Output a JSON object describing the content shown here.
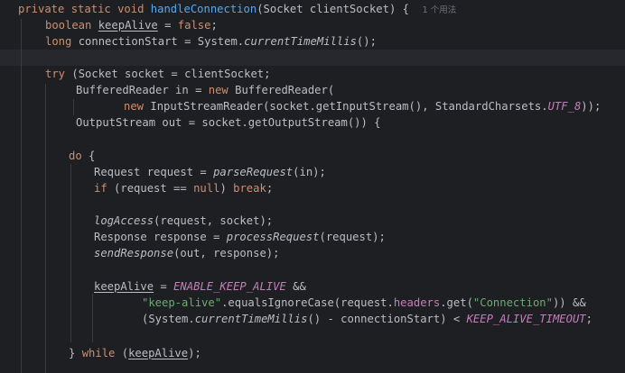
{
  "code": {
    "line1": {
      "kw_private": "private",
      "kw_static": "static",
      "kw_void": "void",
      "method_name": "handleConnection",
      "params": "(Socket clientSocket) {",
      "usage_hint": "1 个用法"
    },
    "line2": {
      "type": "boolean",
      "var": "keepAlive",
      "op": " = ",
      "value": "false",
      "end": ";"
    },
    "line3": {
      "type": "long",
      "var_decl": "connectionStart = System.",
      "method": "currentTimeMillis",
      "end": "();"
    },
    "line5": {
      "kw_try": "try",
      "rest": "(Socket socket = clientSocket;"
    },
    "line6": {
      "decl": "BufferedReader in = ",
      "kw_new": "new",
      "rest": " BufferedReader("
    },
    "line7": {
      "kw_new": "new",
      "rest": " InputStreamReader(socket.getInputStream(), StandardCharsets.",
      "const": "UTF_8",
      "end": "));"
    },
    "line8": {
      "text": "OutputStream out = socket.getOutputStream()) {"
    },
    "line10": {
      "kw_do": "do",
      "rest": " {"
    },
    "line11": {
      "decl": "Request request = ",
      "method": "parseRequest",
      "end": "(in);"
    },
    "line12": {
      "kw_if": "if",
      "mid": " (request == ",
      "kw_null": "null",
      "mid2": ") ",
      "kw_break": "break",
      "end": ";"
    },
    "line14": {
      "method": "logAccess",
      "end": "(request, socket);"
    },
    "line15": {
      "decl": "Response response = ",
      "method": "processRequest",
      "end": "(request);"
    },
    "line16": {
      "method": "sendResponse",
      "end": "(out, response);"
    },
    "line18": {
      "var": "keepAlive",
      "op": " = ",
      "const": "ENABLE_KEEP_ALIVE",
      "end": " &&"
    },
    "line19": {
      "string": "\"keep-alive\"",
      "mid": ".equalsIgnoreCase(request.",
      "field": "headers",
      "mid2": ".get(",
      "string2": "\"Connection\"",
      "end": ")) &&"
    },
    "line20": {
      "start": "(System.",
      "method": "currentTimeMillis",
      "mid": "() - connectionStart) < ",
      "const": "KEEP_ALIVE_TIMEOUT",
      "end": ";"
    },
    "line22": {
      "start": "} ",
      "kw_while": "while",
      "mid": " (",
      "var": "keepAlive",
      "end": ");"
    }
  },
  "colors": {
    "background": "#1e1f22",
    "current_line": "#26282e",
    "keyword": "#cf8e6d",
    "method_declaration": "#56a8f5",
    "field_constant": "#c77dbb",
    "string": "#6aab73",
    "default_text": "#bcbec4"
  }
}
